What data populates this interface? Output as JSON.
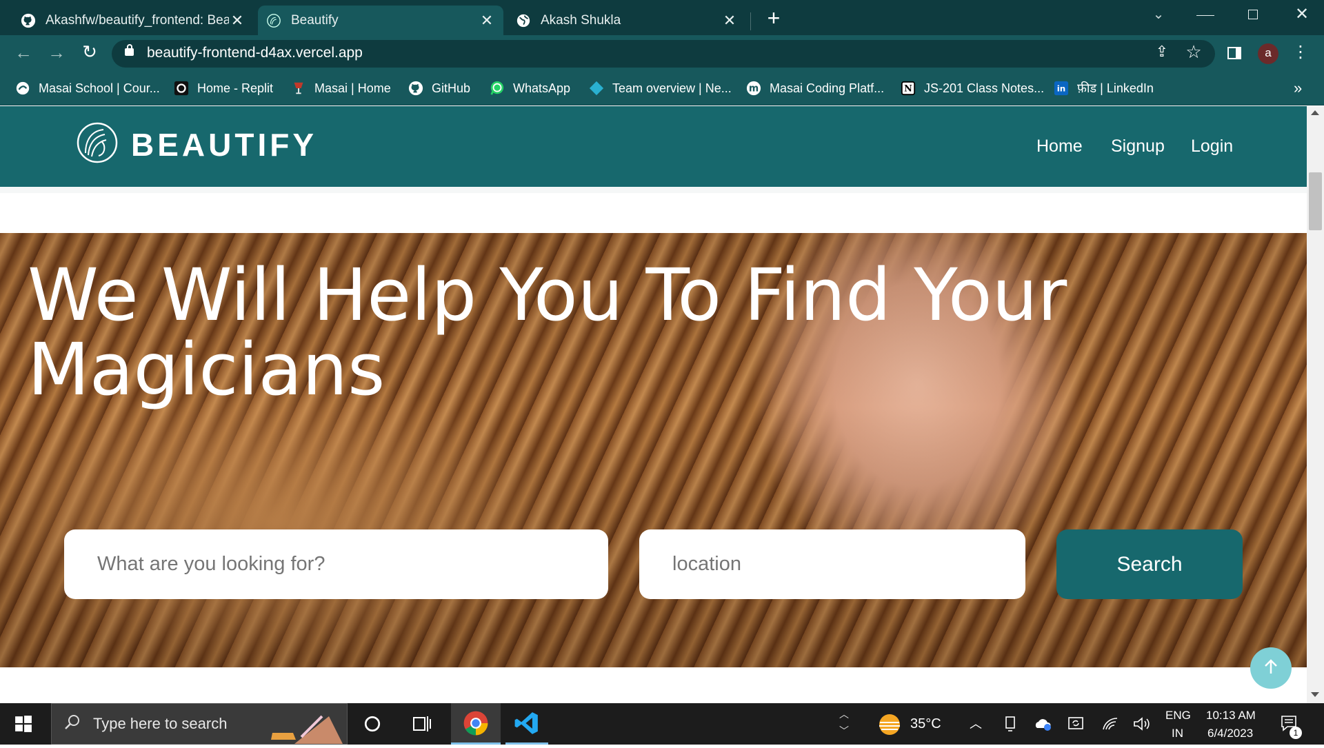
{
  "browser": {
    "tabs": [
      {
        "title": "Akashfw/beautify_frontend: Beau",
        "icon": "github-icon"
      },
      {
        "title": "Beautify",
        "icon": "beautify-logo-icon"
      },
      {
        "title": "Akash Shukla",
        "icon": "globe-icon"
      }
    ],
    "url": "beautify-frontend-d4ax.vercel.app",
    "profile_initial": "a",
    "bookmarks": [
      {
        "label": "Masai School | Cour...",
        "icon": "masai-icon"
      },
      {
        "label": "Home - Replit",
        "icon": "replit-icon"
      },
      {
        "label": "Masai | Home",
        "icon": "masai-cup-icon"
      },
      {
        "label": "GitHub",
        "icon": "github-icon"
      },
      {
        "label": "WhatsApp",
        "icon": "whatsapp-icon"
      },
      {
        "label": "Team overview | Ne...",
        "icon": "diamond-icon"
      },
      {
        "label": "Masai Coding Platf...",
        "icon": "m-icon"
      },
      {
        "label": "JS-201 Class Notes...",
        "icon": "notion-icon"
      },
      {
        "label": "फ़ीड | LinkedIn",
        "icon": "linkedin-icon"
      }
    ],
    "overflow": "»"
  },
  "site": {
    "brand": "BEAUTIFY",
    "nav": [
      "Home",
      "Signup",
      "Login"
    ],
    "hero_title": "We Will Help You To Find Your Magicians",
    "search_placeholder": "What are you looking for?",
    "location_placeholder": "location",
    "search_button": "Search"
  },
  "taskbar": {
    "search_placeholder": "Type here to search",
    "weather": "35°C",
    "lang_top": "ENG",
    "lang_bottom": "IN",
    "time": "10:13 AM",
    "date": "6/4/2023",
    "notifications": "1"
  },
  "colors": {
    "brand": "#17686d",
    "chrome": "#0e3b3f",
    "toolbar": "#17585c"
  }
}
